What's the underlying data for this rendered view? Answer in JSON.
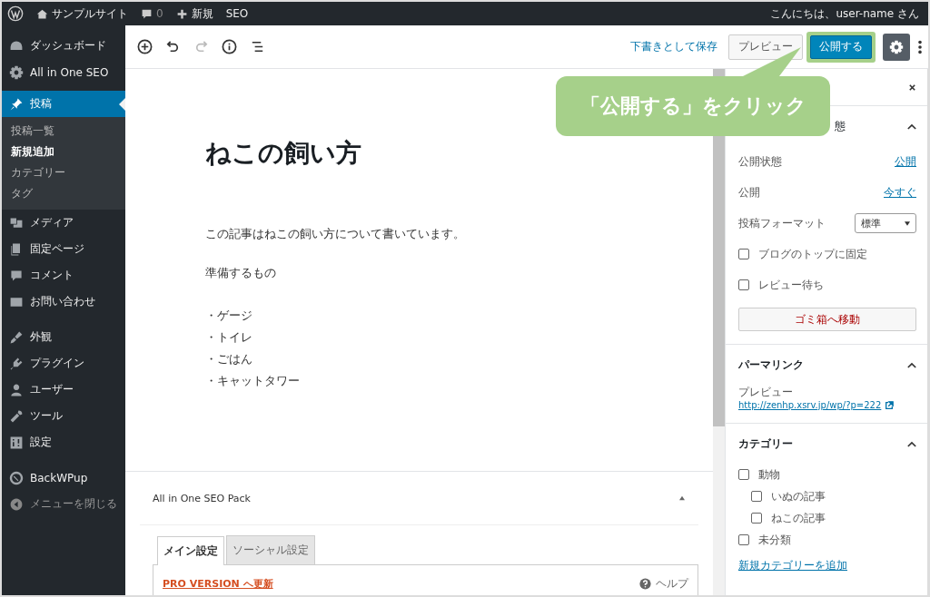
{
  "admin_bar": {
    "site_name": "サンプルサイト",
    "comments": "0",
    "new_label": "新規",
    "seo": "SEO",
    "greeting": "こんにちは、user-name さん"
  },
  "menu_groups": [
    [
      {
        "label": "ダッシュボード",
        "selected": false
      },
      {
        "label": "All in One SEO",
        "selected": false
      },
      {
        "label": "投稿",
        "selected": true,
        "children": [
          {
            "label": "投稿一覧",
            "selected": false
          },
          {
            "label": "新規追加",
            "selected": true
          },
          {
            "label": "カテゴリー",
            "selected": false
          },
          {
            "label": "タグ",
            "selected": false
          }
        ]
      },
      {
        "label": "メディア",
        "selected": false
      },
      {
        "label": "固定ページ",
        "selected": false
      },
      {
        "label": "コメント",
        "selected": false
      },
      {
        "label": "お問い合わせ",
        "selected": false
      }
    ],
    [
      {
        "label": "外観",
        "selected": false
      },
      {
        "label": "プラグイン",
        "selected": false
      },
      {
        "label": "ユーザー",
        "selected": false
      },
      {
        "label": "ツール",
        "selected": false
      },
      {
        "label": "設定",
        "selected": false
      }
    ],
    [
      {
        "label": "BackWPup",
        "selected": false
      },
      {
        "label": "メニューを閉じる",
        "selected": false
      }
    ]
  ],
  "toolbar": {
    "tools": [
      {
        "disabled": false
      },
      {
        "disabled": false
      },
      {
        "disabled": true
      },
      {
        "disabled": false
      },
      {
        "disabled": false
      }
    ],
    "save_draft": "下書きとして保存",
    "preview": "プレビュー",
    "publish": "公開する",
    "settings_pressed": true
  },
  "callout": "「公開する」をクリック",
  "post": {
    "title": "ねこの飼い方",
    "blocks": [
      {
        "kind": "paragraph",
        "text": "この記事はねこの飼い方について書いています。"
      },
      {
        "kind": "paragraph",
        "text": "準備するもの"
      },
      {
        "kind": "list",
        "items": [
          "・ゲージ",
          "・トイレ",
          "・ごはん",
          "・キャットタワー"
        ]
      }
    ]
  },
  "seo_box": {
    "title": "All in One SEO Pack",
    "tabs": [
      {
        "label": "メイン設定",
        "selected": true
      },
      {
        "label": "ソーシャル設定",
        "selected": false
      }
    ],
    "pro_link": "PRO VERSION へ更新",
    "help": "ヘルプ"
  },
  "settings": {
    "status_section": {
      "title": "態",
      "expanded": true,
      "rows": [
        {
          "label": "公開状態",
          "value": "公開"
        },
        {
          "label": "公開",
          "value": "今すぐ"
        }
      ],
      "format_label": "投稿フォーマット",
      "format_value": "標準",
      "checks": [
        {
          "label": "ブログのトップに固定",
          "checked": false
        },
        {
          "label": "レビュー待ち",
          "checked": false
        }
      ],
      "trash": "ゴミ箱へ移動"
    },
    "permalink_section": {
      "title": "パーマリンク",
      "expanded": true,
      "label": "プレビュー",
      "url": "http://zenhp.xsrv.jp/wp/?p=222"
    },
    "category_section": {
      "title": "カテゴリー",
      "expanded": true,
      "categories": [
        {
          "label": "動物",
          "checked": false,
          "children": [
            {
              "label": "いぬの記事",
              "checked": false
            },
            {
              "label": "ねこの記事",
              "checked": false
            }
          ]
        },
        {
          "label": "未分類",
          "checked": false
        }
      ],
      "add_link": "新規カテゴリーを追加"
    }
  }
}
